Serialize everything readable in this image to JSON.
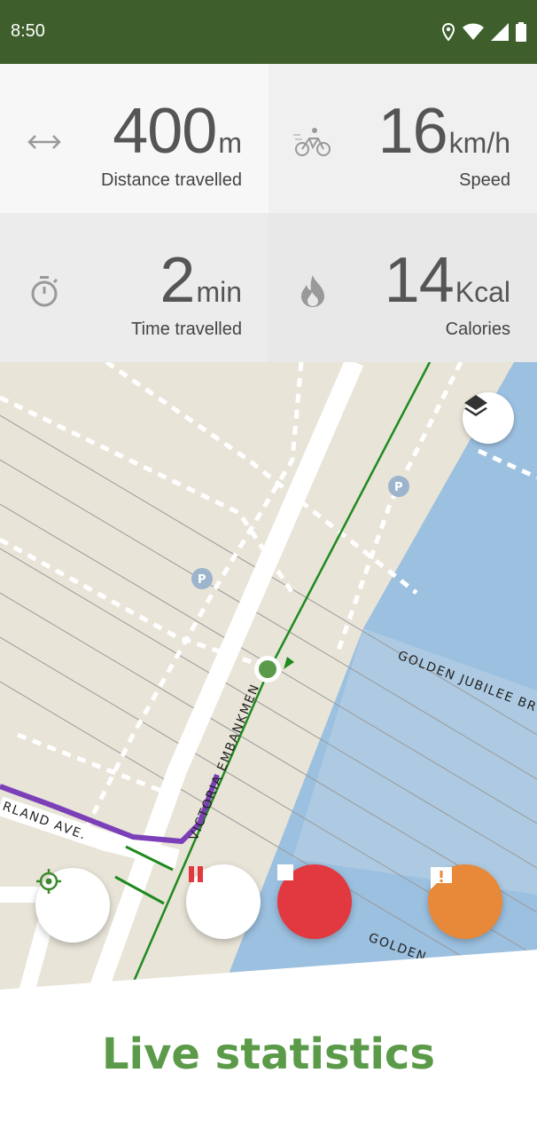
{
  "status_bar": {
    "time": "8:50",
    "icons": [
      "location-icon",
      "wifi-icon",
      "signal-icon",
      "battery-icon"
    ]
  },
  "stats": [
    {
      "icon": "distance-arrows-icon",
      "value": "400",
      "unit": "m",
      "label": "Distance travelled"
    },
    {
      "icon": "cyclist-icon",
      "value": "16",
      "unit": "km/h",
      "label": "Speed"
    },
    {
      "icon": "stopwatch-icon",
      "value": "2",
      "unit": "min",
      "label": "Time travelled"
    },
    {
      "icon": "flame-icon",
      "value": "14",
      "unit": "Kcal",
      "label": "Calories"
    }
  ],
  "map": {
    "street_labels": [
      "GOLDEN JUBILEE BR",
      "VICTORIA EMBANKMEN",
      "RLAND AVE.",
      "GOLDEN"
    ],
    "parking_label": "P",
    "colors": {
      "land": "#e8e4d8",
      "water": "#9cc0e0",
      "route": "#7b3fb8",
      "rail": "#1f8a1f"
    }
  },
  "controls": {
    "recenter": "crosshair-icon",
    "pause": "pause-icon",
    "stop": "stop-icon",
    "report": "report-icon",
    "layers": "layers-icon"
  },
  "footer": {
    "title": "Live statistics"
  },
  "colors": {
    "brand_dark": "#3e5f2c",
    "brand_green": "#5a9a48",
    "stop_red": "#e2383f",
    "report_orange": "#e8893a"
  }
}
